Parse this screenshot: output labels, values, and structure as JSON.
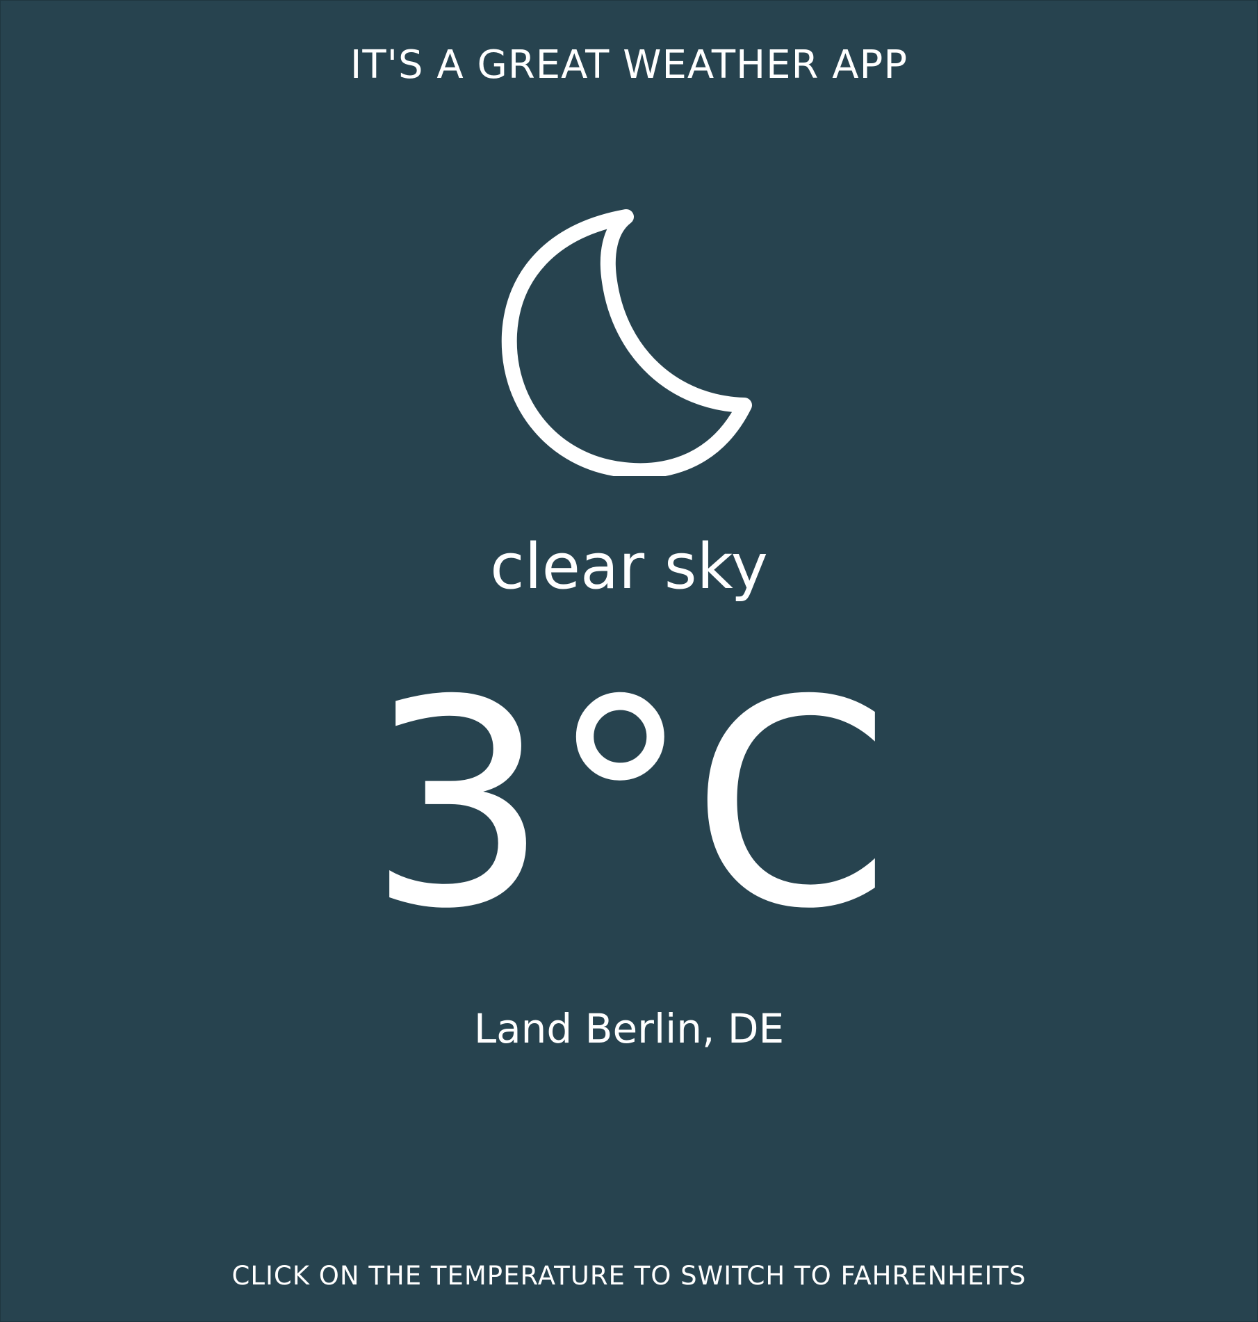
{
  "app": {
    "title": "IT'S A GREAT WEATHER APP"
  },
  "weather": {
    "icon": "moon-icon",
    "condition": "clear sky",
    "temperature": "3°C",
    "location": "Land Berlin, DE"
  },
  "footer": {
    "hint": "CLICK ON THE TEMPERATURE TO SWITCH TO FAHRENHEITS"
  },
  "colors": {
    "background": "#27434f",
    "text": "#ffffff"
  }
}
